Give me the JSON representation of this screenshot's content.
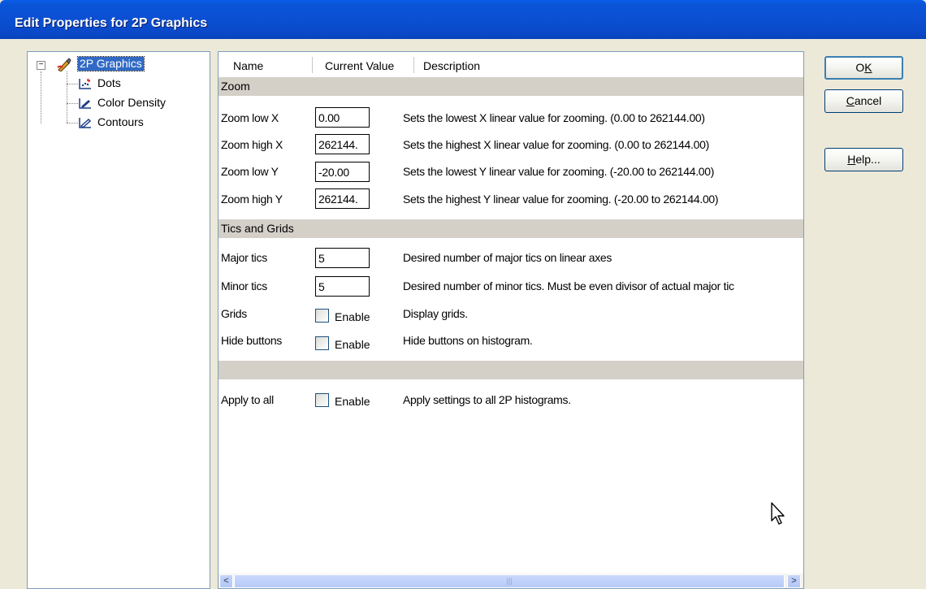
{
  "window": {
    "title": "Edit Properties for 2P Graphics"
  },
  "tree": {
    "root": {
      "label": "2P Graphics",
      "icon": "paintbrush-icon"
    },
    "children": [
      {
        "label": "Dots",
        "icon": "dot-plot-icon"
      },
      {
        "label": "Color Density",
        "icon": "color-density-plot-icon"
      },
      {
        "label": "Contours",
        "icon": "contour-plot-icon"
      }
    ]
  },
  "grid": {
    "headers": {
      "name": "Name",
      "value": "Current Value",
      "description": "Description"
    },
    "sections": {
      "zoom": "Zoom",
      "tics": "Tics and Grids",
      "blank": ""
    },
    "rows": {
      "zoom_low_x": {
        "label": "Zoom low X",
        "value": "0.00",
        "description": "Sets the lowest X linear value for zooming. (0.00 to 262144.00)"
      },
      "zoom_high_x": {
        "label": "Zoom high X",
        "value": "262144.",
        "description": "Sets the highest X linear value for zooming. (0.00 to 262144.00)"
      },
      "zoom_low_y": {
        "label": "Zoom low Y",
        "value": "-20.00",
        "description": "Sets the lowest Y linear value for zooming. (-20.00 to 262144.00)"
      },
      "zoom_high_y": {
        "label": "Zoom high Y",
        "value": "262144.",
        "description": "Sets the highest Y linear value for zooming. (-20.00 to 262144.00)"
      },
      "major_tics": {
        "label": "Major tics",
        "value": "5",
        "description": "Desired number of major tics on linear axes"
      },
      "minor_tics": {
        "label": "Minor tics",
        "value": "5",
        "description": "Desired number of minor tics. Must be even divisor of actual major tic"
      },
      "grids": {
        "label": "Grids",
        "checkbox_label": "Enable",
        "checked": false,
        "description": "Display grids."
      },
      "hide_buttons": {
        "label": "Hide buttons",
        "checkbox_label": "Enable",
        "checked": false,
        "description": "Hide buttons on histogram."
      },
      "apply_to_all": {
        "label": "Apply to all",
        "checkbox_label": "Enable",
        "checked": false,
        "description": "Apply settings to all 2P histograms."
      }
    },
    "scrollbar": {
      "left_arrow": "<",
      "right_arrow": ">",
      "grip": "|||"
    }
  },
  "buttons": {
    "ok": {
      "label": "OK",
      "mnemonic": "K"
    },
    "cancel": {
      "label": "Cancel",
      "mnemonic": "C"
    },
    "help": {
      "label": "Help...",
      "mnemonic": "H"
    }
  },
  "colors": {
    "titlebar": "#0a54d8",
    "selection": "#316ac5",
    "section_bg": "#d4d0c8",
    "dialog_bg": "#ece9d8"
  }
}
